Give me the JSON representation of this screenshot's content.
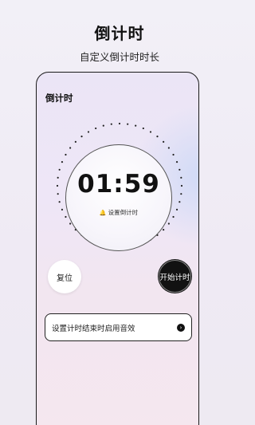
{
  "promo": {
    "title": "倒计时",
    "subtitle": "自定义倒计时时长"
  },
  "screen": {
    "title": "倒计时",
    "timer": {
      "time": "01:59",
      "set_label": "设置倒计时",
      "set_icon": "bell-icon"
    },
    "buttons": {
      "reset": "复位",
      "start": "开始计时"
    },
    "sound_option": {
      "label": "设置计时结束时启用音效",
      "icon": "chevron-right-icon"
    }
  },
  "colors": {
    "accent_dark": "#121212",
    "background": "#f2f0f7"
  }
}
